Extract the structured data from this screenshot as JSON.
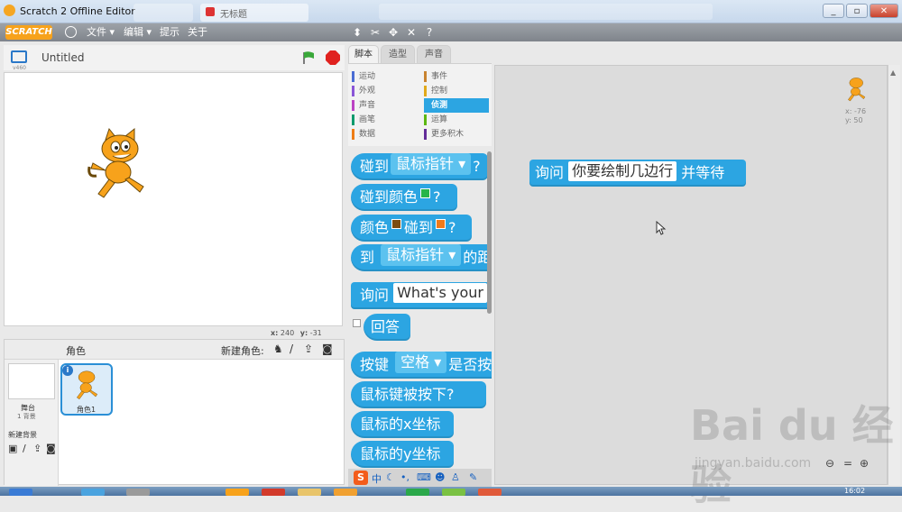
{
  "window": {
    "title": "Scratch 2 Offline Editor",
    "tabs": [
      "",
      "无标题"
    ],
    "controls": [
      "_",
      "▫",
      "✕"
    ]
  },
  "menubar": {
    "logo": "SCRATCH",
    "menus": [
      "文件",
      "编辑",
      "提示",
      "关于"
    ],
    "tools": [
      "duplicate",
      "delete",
      "grow",
      "shrink",
      "help"
    ]
  },
  "stage": {
    "title": "Untitled",
    "version": "v460",
    "coords": {
      "x_label": "x:",
      "x_value": "240",
      "y_label": "y:",
      "y_value": "-31"
    }
  },
  "sprites": {
    "label": "角色",
    "new_sprite_label": "新建角色:",
    "stage_label": "舞台",
    "backdrop_count": "1 背景",
    "new_backdrop_label": "新建背景",
    "sprite_name": "角色1"
  },
  "palette": {
    "tabs": [
      "脚本",
      "造型",
      "声音"
    ],
    "categories_left": [
      {
        "label": "运动",
        "color": "#4a6cd4"
      },
      {
        "label": "外观",
        "color": "#8a55d7"
      },
      {
        "label": "声音",
        "color": "#bb42c3"
      },
      {
        "label": "画笔",
        "color": "#0e9a6c"
      },
      {
        "label": "数据",
        "color": "#ee7d16"
      }
    ],
    "categories_right": [
      {
        "label": "事件",
        "color": "#c88330"
      },
      {
        "label": "控制",
        "color": "#e1a91a"
      },
      {
        "label": "侦测",
        "color": "#2ca5e2",
        "active": true
      },
      {
        "label": "运算",
        "color": "#5cb712"
      },
      {
        "label": "更多积木",
        "color": "#632d99"
      }
    ],
    "blocks": {
      "touching": {
        "label": "碰到",
        "dropdown": "鼠标指针",
        "suffix": "?"
      },
      "touching_color": {
        "label": "碰到颜色",
        "suffix": "?"
      },
      "color_touching": {
        "label": "颜色",
        "mid": "碰到",
        "suffix": "?"
      },
      "distance": {
        "label": "到",
        "dropdown": "鼠标指针",
        "suffix": "的距"
      },
      "ask": {
        "label": "询问",
        "input": "What's your"
      },
      "answer": {
        "label": "回答"
      },
      "key_pressed": {
        "label": "按键",
        "dropdown": "空格",
        "suffix": "是否按"
      },
      "mouse_down": {
        "label": "鼠标键被按下?"
      },
      "mouse_x": {
        "label": "鼠标的x坐标"
      },
      "mouse_y": {
        "label": "鼠标的y坐标"
      }
    }
  },
  "script": {
    "ask_label": "询问",
    "ask_input": "你要绘制几边行",
    "ask_suffix": "并等待",
    "sprite_x": "x: -76",
    "sprite_y": "y: 50"
  },
  "watermark": {
    "main": "Bai du 经验",
    "url": "jingyan.baidu.com"
  },
  "taskbar": {
    "clock": "16:02"
  }
}
